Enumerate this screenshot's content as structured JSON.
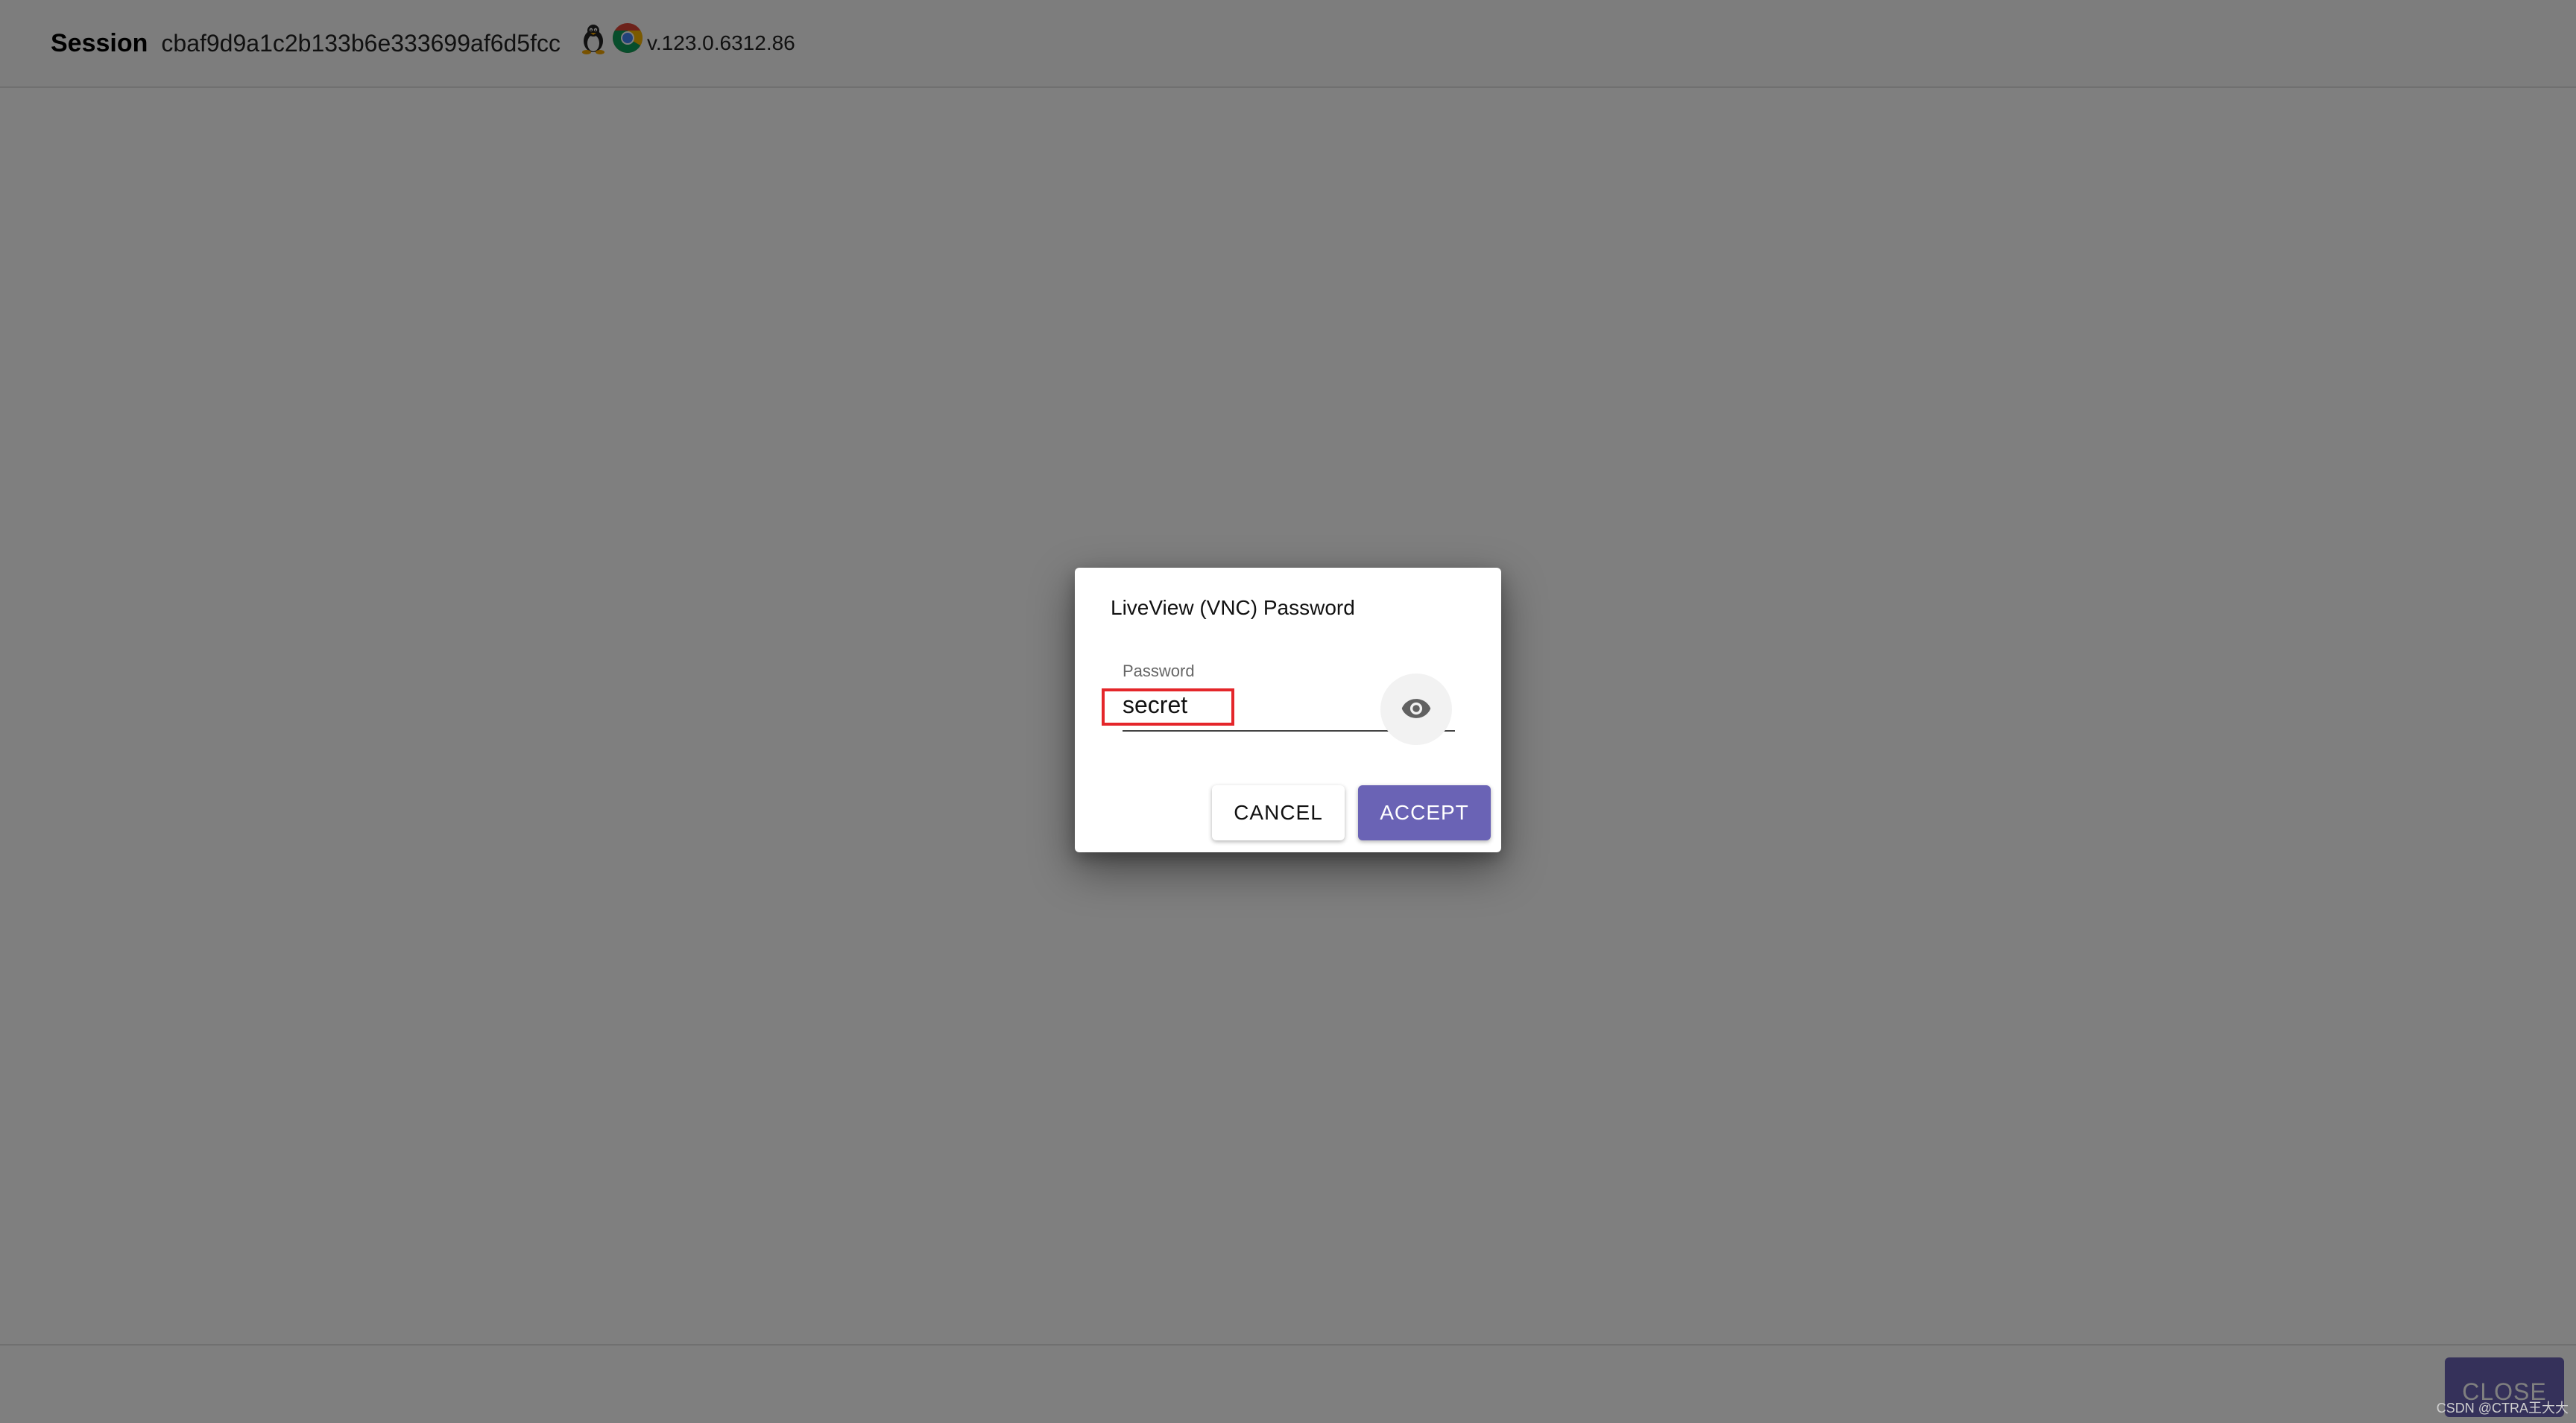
{
  "header": {
    "session_label": "Session",
    "session_id": "cbaf9d9a1c2b133b6e333699af6d5fcc",
    "platform_icon": "linux-tux-icon",
    "browser_icon": "chrome-icon",
    "browser_version": "v.123.0.6312.86"
  },
  "dialog": {
    "title": "LiveView (VNC) Password",
    "field_label": "Password",
    "password_value": "secret",
    "visibility_icon": "eye-icon",
    "highlight_color": "#e4262a",
    "cancel_label": "CANCEL",
    "accept_label": "ACCEPT"
  },
  "footer": {
    "close_label": "CLOSE",
    "watermark": "CSDN @CTRA王大大"
  },
  "colors": {
    "accent": "#6a63b5",
    "backdrop": "rgba(0,0,0,0.5)"
  }
}
